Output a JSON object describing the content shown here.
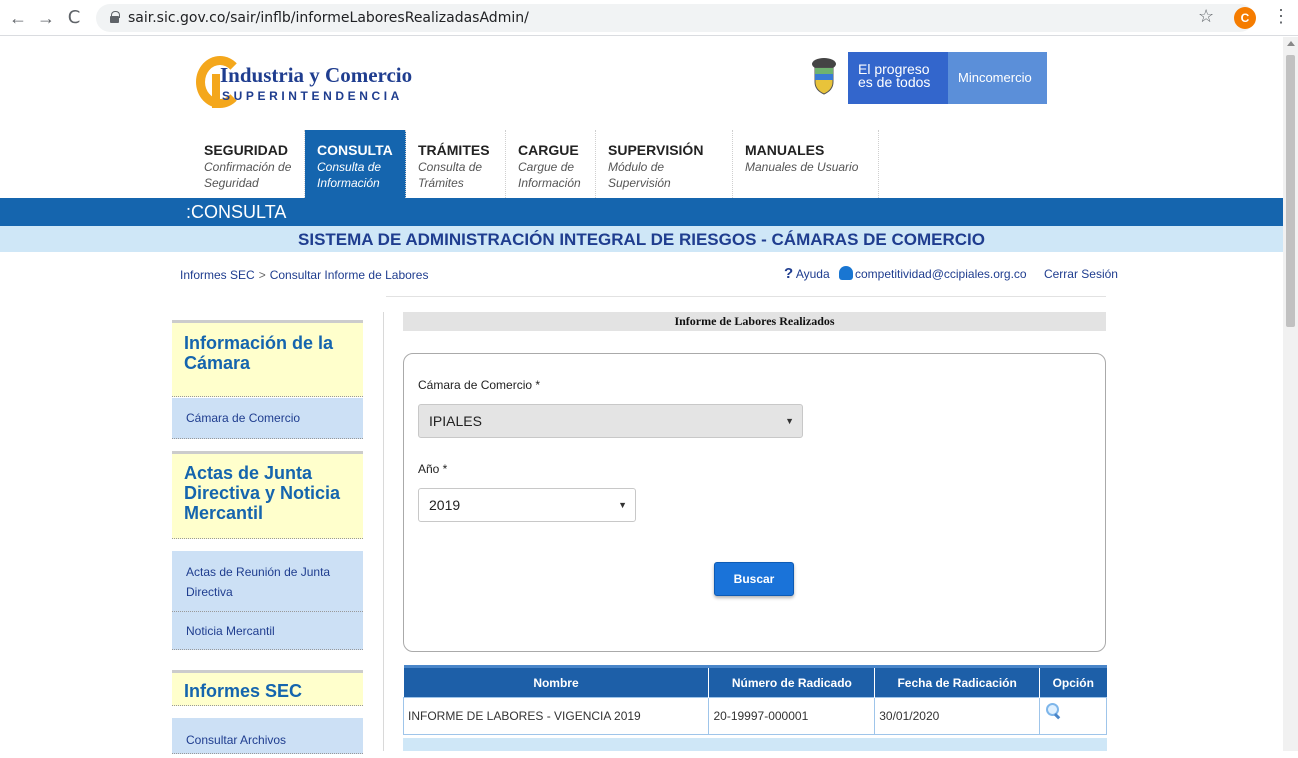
{
  "browser": {
    "url": "sair.sic.gov.co/sair/inflb/informeLaboresRealizadasAdmin/",
    "back": "←",
    "forward": "→",
    "reload": "C",
    "star": "☆",
    "profile_initial": "C",
    "menu": "⋮"
  },
  "header": {
    "logo_title": "Industria y Comercio",
    "logo_subtitle": "SUPERINTENDENCIA",
    "gov_line1": "El progreso",
    "gov_line2": "es de todos",
    "ministry": "Mincomercio"
  },
  "nav": [
    {
      "title": "SEGURIDAD",
      "sub1": "Confirmación de",
      "sub2": "Seguridad"
    },
    {
      "title": "CONSULTA",
      "sub1": "Consulta de",
      "sub2": "Información"
    },
    {
      "title": "TRÁMITES",
      "sub1": "Consulta de",
      "sub2": "Trámites"
    },
    {
      "title": "CARGUE",
      "sub1": "Cargue de",
      "sub2": "Información"
    },
    {
      "title": "SUPERVISIÓN",
      "sub1": "Módulo de Supervisión",
      "sub2": ""
    },
    {
      "title": "MANUALES",
      "sub1": "Manuales de Usuario",
      "sub2": ""
    }
  ],
  "section": {
    "label": "CONSULTA",
    "prefix": ":",
    "system_title": "SISTEMA DE ADMINISTRACIÓN INTEGRAL DE RIESGOS - CÁMARAS DE COMERCIO"
  },
  "breadcrumb": {
    "item1": "Informes SEC",
    "sep": ">",
    "item2": "Consultar Informe de Labores"
  },
  "userbar": {
    "help": "Ayuda",
    "help_mark": "?",
    "email": "competitividad@ccipiales.org.co",
    "logout": "Cerrar Sesión"
  },
  "sidebar": {
    "sections": [
      {
        "title": "Información de la Cámara",
        "items": [
          "Cámara de Comercio"
        ]
      },
      {
        "title": "Actas de Junta Directiva y Noticia Mercantil",
        "items": [
          "Actas de Reunión de Junta Directiva",
          "Noticia Mercantil"
        ]
      },
      {
        "title": "Informes SEC",
        "items": [
          "Consultar Archivos"
        ]
      }
    ]
  },
  "form": {
    "title": "Informe de Labores Realizados",
    "camara_label": "Cámara de Comercio *",
    "camara_value": "IPIALES",
    "anio_label": "Año *",
    "anio_value": "2019",
    "caret": "▼",
    "search_button": "Buscar"
  },
  "table": {
    "headers": [
      "Nombre",
      "Número de Radicado",
      "Fecha de Radicación",
      "Opción"
    ],
    "rows": [
      {
        "nombre": "INFORME DE LABORES - VIGENCIA 2019",
        "radicado": "20-19997-000001",
        "fecha": "30/01/2020"
      }
    ]
  },
  "colors": {
    "primary_blue": "#1565ae",
    "light_blue": "#cfe7f7",
    "sidebar_yellow": "#ffffcc",
    "logo_orange": "#f4a71c"
  }
}
